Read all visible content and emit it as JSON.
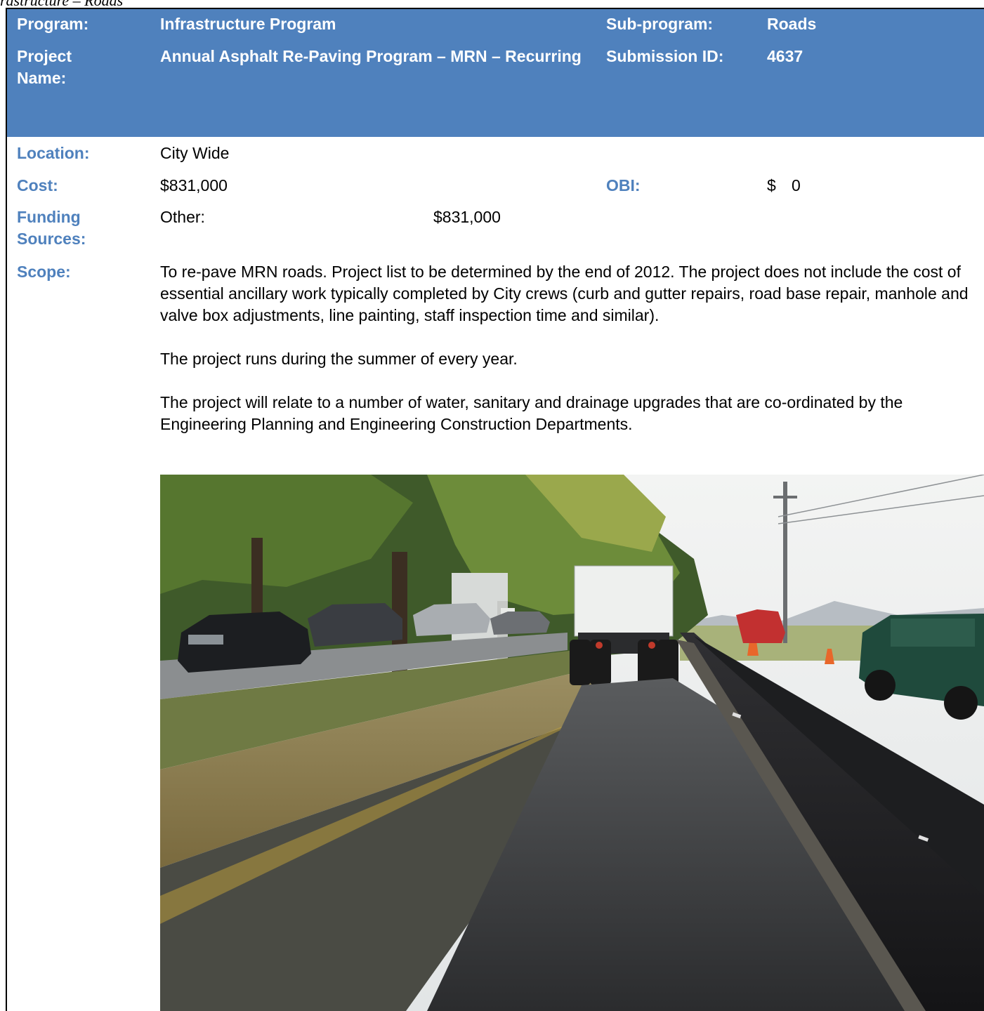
{
  "running_head": "rastructure – Roads",
  "header": {
    "program_label": "Program:",
    "program_value": "Infrastructure Program",
    "subprogram_label": "Sub-program:",
    "subprogram_value": "Roads",
    "project_label": "Project Name:",
    "project_value": "Annual Asphalt Re-Paving Program – MRN – Recurring",
    "submission_label": "Submission ID:",
    "submission_value": "4637"
  },
  "details": {
    "location_label": "Location:",
    "location_value": "City Wide",
    "cost_label": "Cost:",
    "cost_value": "$831,000",
    "obi_label": "OBI:",
    "obi_currency": "$",
    "obi_value": "0",
    "funding_label": "Funding Sources:",
    "funding_source": "Other:",
    "funding_amount": "$831,000",
    "scope_label": "Scope:",
    "scope_p1": "To re-pave MRN roads. Project list to be determined by the end of 2012.  The project does not include the cost of essential ancillary work typically completed by City crews (curb and gutter repairs, road base repair, manhole and valve box adjustments, line painting, staff inspection time and similar).",
    "scope_p2": "The project runs during the summer of every year.",
    "scope_p3": "The project will relate to a number of water, sanitary and drainage upgrades that are co-ordinated by the Engineering Planning and Engineering Construction Departments."
  }
}
